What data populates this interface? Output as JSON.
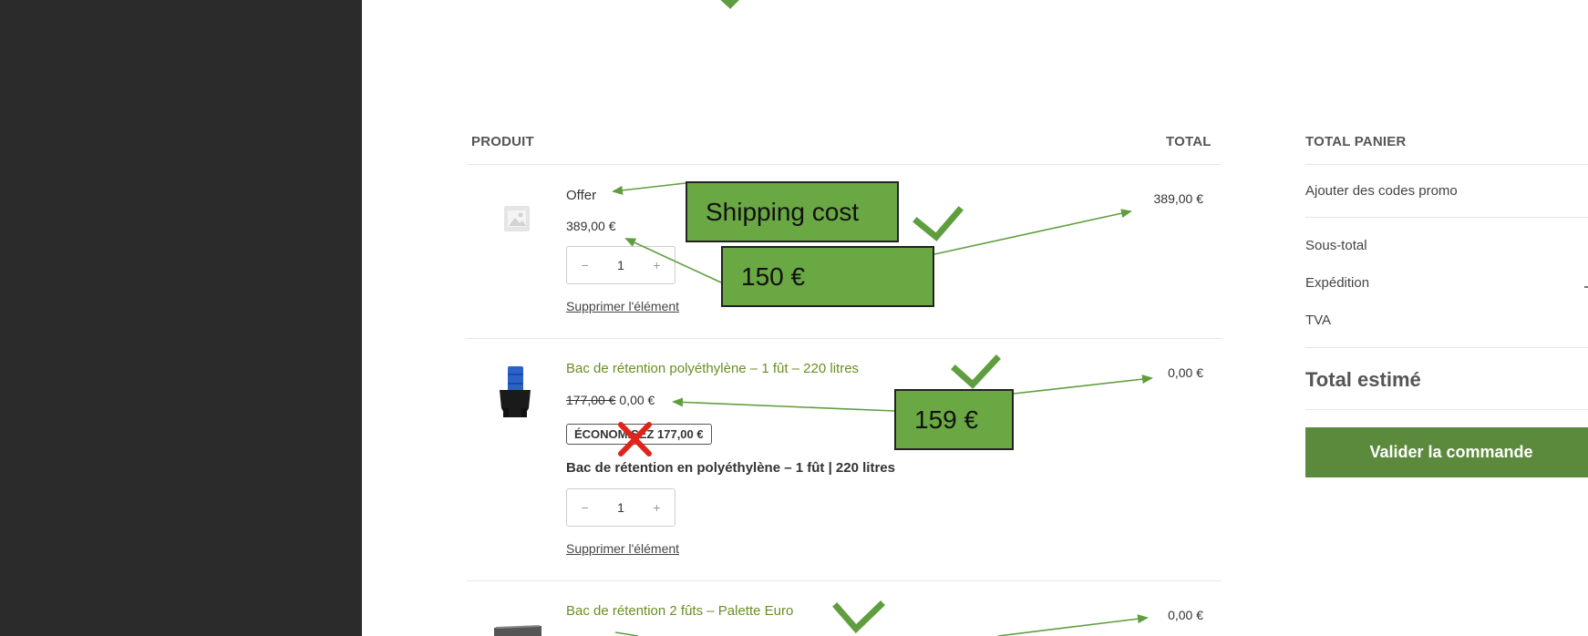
{
  "table": {
    "header_product": "PRODUIT",
    "header_total": "TOTAL"
  },
  "items": [
    {
      "name": "Offer",
      "price": "389,00 €",
      "qty": "1",
      "remove": "Supprimer l'élément",
      "total": "389,00 €",
      "image_icon": "image-placeholder-icon"
    },
    {
      "name": "Bac de rétention polyéthylène – 1 fût – 220 litres",
      "old_price": "177,00 €",
      "price": "0,00 €",
      "badge": "ÉCONOMISEZ 177,00 €",
      "description": "Bac de rétention en polyéthylène – 1 fût | 220 litres",
      "qty": "1",
      "remove": "Supprimer l'élément",
      "total": "0,00 €",
      "image_icon": "blue-drum-on-black-tray-image"
    },
    {
      "name": "Bac de rétention 2 fûts – Palette Euro",
      "total": "0,00 €",
      "image_icon": "grey-retention-tray-image"
    }
  ],
  "qty_controls": {
    "minus": "−",
    "plus": "+"
  },
  "panel": {
    "title": "TOTAL PANIER",
    "promo": "Ajouter des codes promo",
    "subtotal": "Sous-total",
    "shipping": "Expédition",
    "tax": "TVA",
    "estimated": "Total estimé",
    "checkout": "Valider la commande"
  },
  "annotations": {
    "shipping_cost": "Shipping cost",
    "price_150": "150 €",
    "price_159": "159 €"
  },
  "colors": {
    "sidebar": "#2b2b2b",
    "annotation_green": "#6aa844",
    "arrow_green": "#5f9e3e",
    "checkout_button": "#5c8a3c",
    "cross_red": "#e0241b",
    "link_green": "#6b8e23"
  }
}
